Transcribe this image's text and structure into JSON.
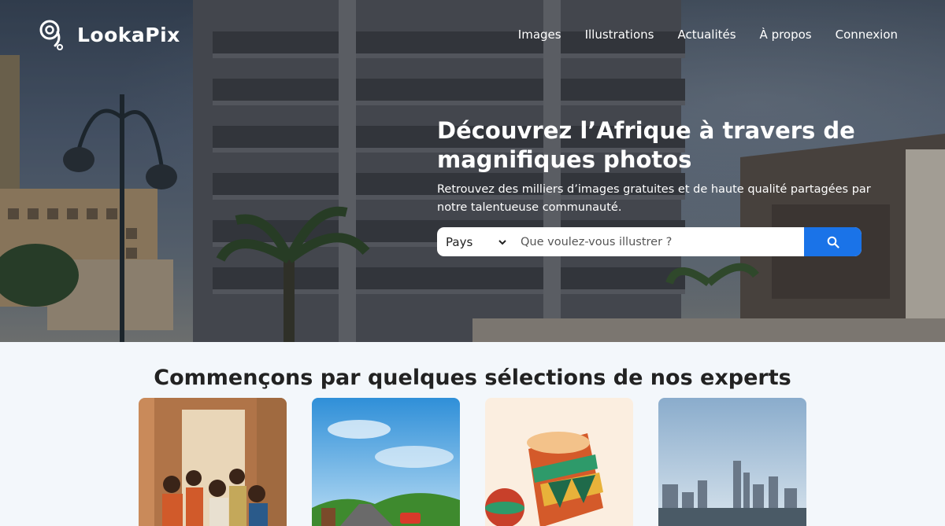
{
  "brand": {
    "name": "LookaPix"
  },
  "nav": {
    "items": [
      {
        "label": "Images"
      },
      {
        "label": "Illustrations"
      },
      {
        "label": "Actualités"
      },
      {
        "label": "À propos"
      },
      {
        "label": "Connexion"
      }
    ]
  },
  "hero": {
    "title": "Découvrez l’Afrique à travers de magnifiques photos",
    "subtitle": "Retrouvez des milliers d’images gratuites et de haute qualité partagées par notre talentueuse communauté."
  },
  "search": {
    "country_value": "Pays",
    "placeholder": "Que voulez-vous illustrer ?",
    "button_icon": "search-icon"
  },
  "section": {
    "title": "Commençons par quelques sélections de nos experts"
  },
  "colors": {
    "accent": "#1a73e8",
    "background": "#f3f7fb"
  }
}
